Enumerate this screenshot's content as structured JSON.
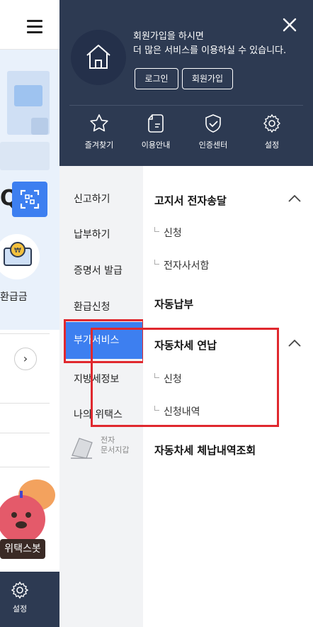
{
  "background": {
    "refund_label": "환급금",
    "bot_label": "위택스봇",
    "settings_label": "설정"
  },
  "drawer": {
    "welcome_line1": "회원가입을 하시면",
    "welcome_line2": "더 많은 서비스를 이용하실 수 있습니다.",
    "login_label": "로그인",
    "join_label": "회원가입",
    "quick_menu": [
      {
        "label": "즐겨찾기",
        "icon": "star-icon"
      },
      {
        "label": "이용안내",
        "icon": "document-icon"
      },
      {
        "label": "인증센터",
        "icon": "shield-check-icon"
      },
      {
        "label": "설정",
        "icon": "gear-icon"
      }
    ]
  },
  "left_menu": [
    {
      "label": "신고하기"
    },
    {
      "label": "납부하기"
    },
    {
      "label": "증명서 발급"
    },
    {
      "label": "환급신청"
    },
    {
      "label": "부가서비스",
      "active": true
    },
    {
      "label": "지방세정보"
    },
    {
      "label": "나의 위택스"
    }
  ],
  "edoc": {
    "line1": "전자",
    "line2": "문서지갑"
  },
  "right_menu": {
    "group1": {
      "title": "고지서 전자송달",
      "subs": [
        "신청",
        "전자사서함"
      ]
    },
    "group2": {
      "title": "자동납부"
    },
    "group3": {
      "title": "자동차세 연납",
      "subs": [
        "신청",
        "신청내역"
      ]
    },
    "group4": {
      "title": "자동차세 체납내역조회"
    }
  },
  "colors": {
    "drawer_header": "#2d3a52",
    "active_blue": "#3d7ff0",
    "highlight_red": "#e0282e",
    "left_menu_bg": "#f2f3f5"
  }
}
